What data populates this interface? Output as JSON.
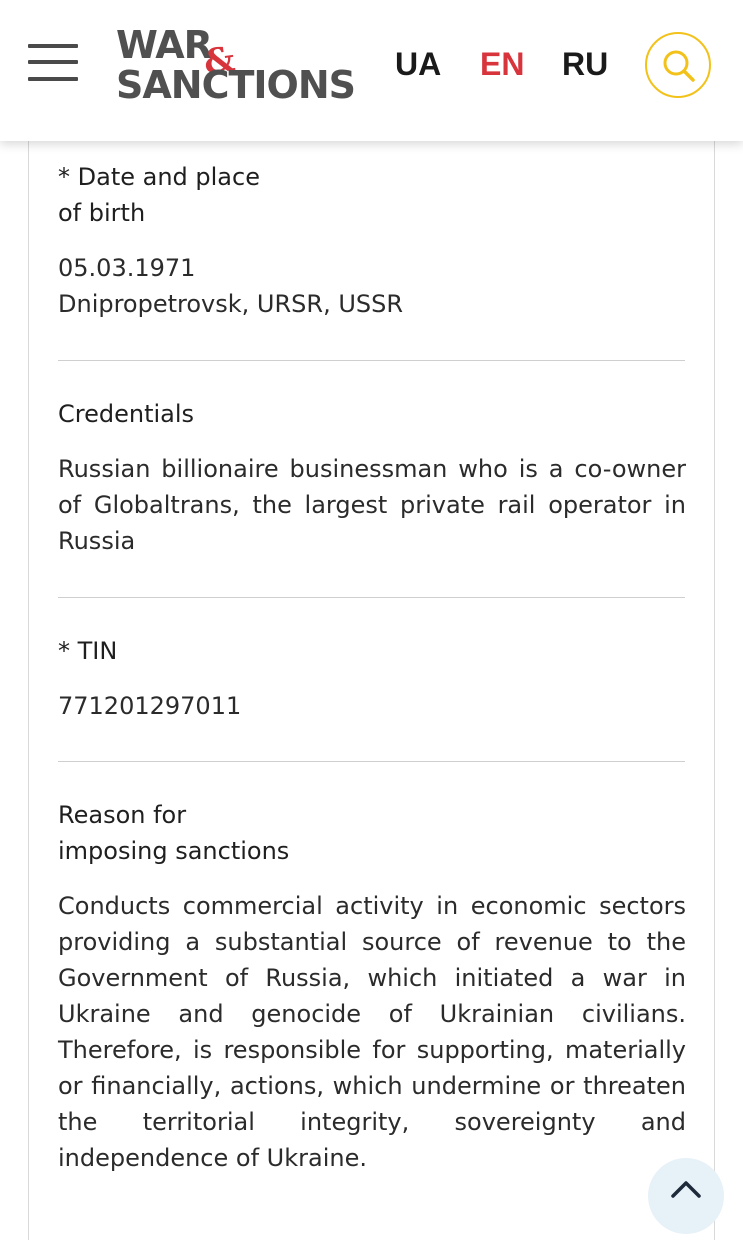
{
  "header": {
    "logo": {
      "line1": "WAR",
      "ampersand": "&",
      "line2": "SANCTIONS"
    },
    "languages": [
      {
        "code": "UA",
        "active": false
      },
      {
        "code": "EN",
        "active": true
      },
      {
        "code": "RU",
        "active": false
      }
    ],
    "menu_icon": "hamburger-menu-icon",
    "search_icon": "search-icon",
    "colors": {
      "accent": "#d8343c",
      "search_ring": "#f2c21b",
      "logo_text": "#505050"
    }
  },
  "profile": {
    "birth": {
      "label_line1": "* Date and place",
      "label_line2": "of birth",
      "date": "05.03.1971",
      "place": "Dnipropetrovsk, URSR, USSR"
    },
    "credentials": {
      "label": "Credentials",
      "text": "Russian billionaire businessman who is a co-owner of Globaltrans, the largest private rail operator in Russia"
    },
    "tin": {
      "label": "* TIN",
      "value": "771201297011"
    },
    "reason": {
      "label_line1": "Reason for",
      "label_line2": "imposing sanctions",
      "text": "Conducts commercial activity in economic sectors providing a substantial source of revenue to the Government of Russia, which initiated a war in Ukraine and genocide of Ukrainian civilians. Therefore, is responsible for supporting, materially or financially, actions, which undermine or threaten the territorial integrity, sovereignty and independence of Ukraine."
    }
  },
  "scroll_top_icon": "chevron-up-icon"
}
